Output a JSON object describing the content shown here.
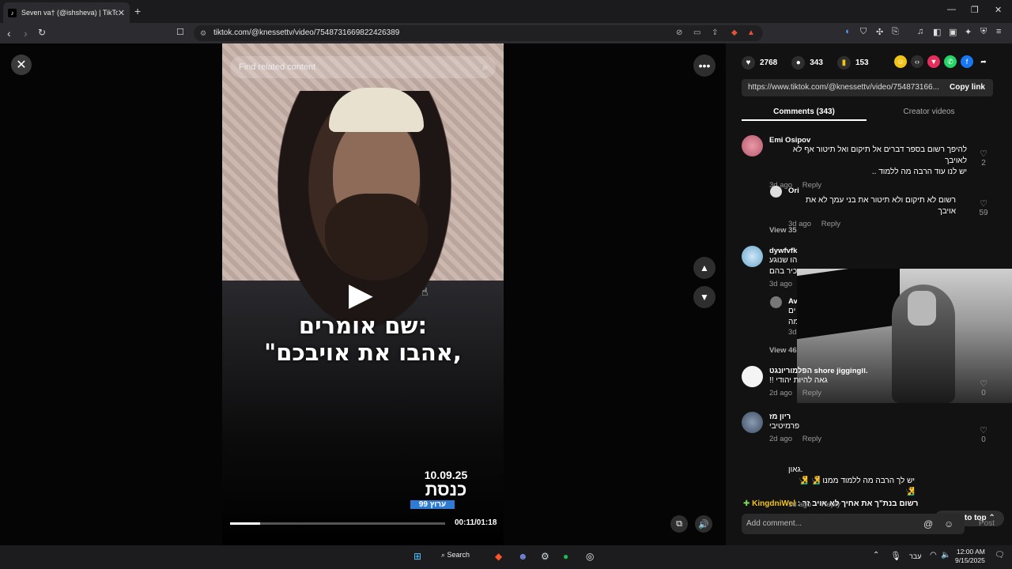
{
  "browser": {
    "tab_title": "Seven va† (@ishsheva) | TikTok",
    "tab_favicon": "tiktok-icon",
    "url": "tiktok.com/@knessettv/video/7548731669822426389",
    "new_tab": "+",
    "close_tab": "✕"
  },
  "video": {
    "search_placeholder": "Find related content",
    "caption_line1": "שם אומרים:",
    "caption_line2": "\"אהבו את אויבכם,",
    "logo_date": "10.09.25",
    "logo_name": "כנסת",
    "logo_channel": "ערוץ 99",
    "time": "00:11/01:18",
    "progress": 0.14
  },
  "panel": {
    "likes": "2768",
    "comments": "343",
    "saves": "153",
    "link": "https://www.tiktok.com/@knessettv/video/754873166...",
    "copy_link": "Copy link",
    "tab_comments": "Comments (343)",
    "tab_creator": "Creator videos",
    "comments_list": [
      {
        "name": "Emi Osipov",
        "line1": "להיפך רשום בספר דברים אל תיקום ואל תיטור אף לא לאויבך",
        "line2": "יש לנו עוד הרבה מה ללמוד ..",
        "date": "3d ago",
        "reply": "Reply",
        "likes": "2"
      },
      {
        "name": "Ori",
        "line1": "רשום לא תיקום ולא תיטור את בני עמך לא את אויבך",
        "date": "3d ago",
        "reply": "Reply",
        "likes": "59"
      },
      {
        "name": "dywfvfk",
        "line1": "הו שנוגע",
        "line2": "כיר בהם",
        "date": "3d ago"
      },
      {
        "name": "Av",
        "line1": "ים",
        "line2": "מה",
        "date": "3d"
      },
      {
        "name": "הפלמוריונגט shore jiggingוו.",
        "line1": "!! גאה להיות יהודי",
        "date": "2d ago",
        "reply": "Reply",
        "likes": "0"
      },
      {
        "name": "ריון מז",
        "line1": "פרמיטיבי",
        "date": "2d ago",
        "reply": "Reply",
        "likes": "0"
      },
      {
        "line1": "גאון.",
        "line2": "יש לך הרבה מה ללמוד ממנו 🧏‍♂️ 🧏‍♂️ 🧏‍♂️",
        "date": "1d ago",
        "reply": "Reply"
      }
    ],
    "view_more_1": "View 35",
    "view_more_2": "View 46",
    "kingbar_name": "KingdniWel",
    "kingbar_text": ": רשום בנת\"ך את אחיך לא אויב זר",
    "back_to_top": "Back to top",
    "add_comment": "Add comment...",
    "post": "Post"
  },
  "taskbar": {
    "search": "Search",
    "lang": "עבר",
    "time": "12:00 AM",
    "date": "9/15/2025"
  }
}
